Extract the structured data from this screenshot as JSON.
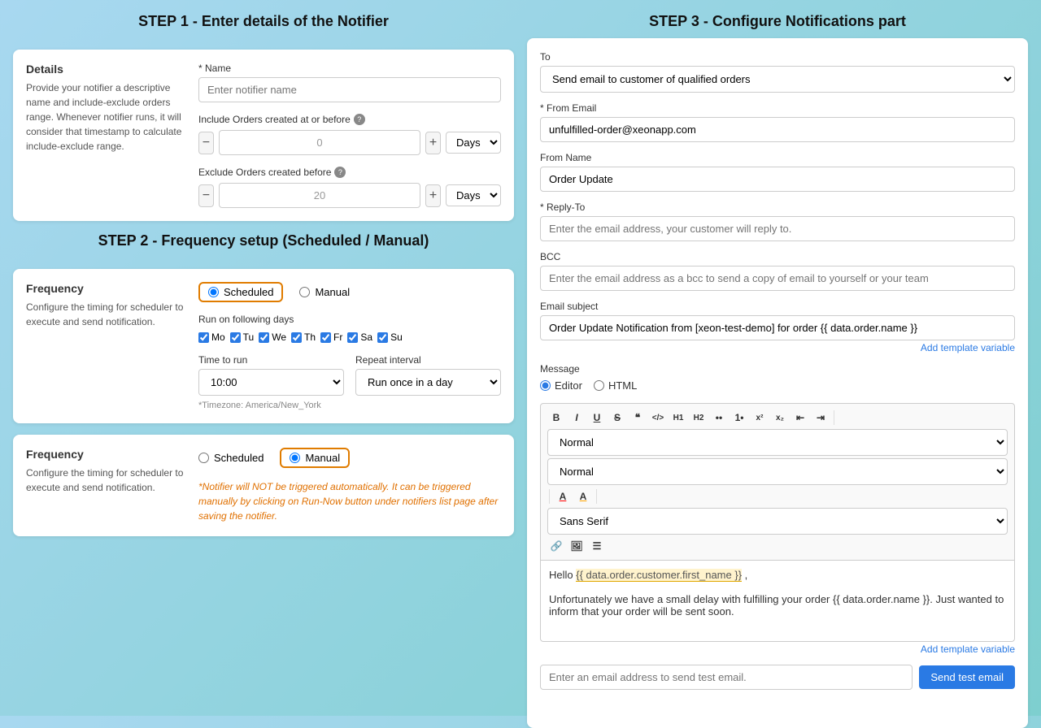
{
  "step1": {
    "title": "STEP 1 - Enter details of the Notifier",
    "details_card": {
      "heading": "Details",
      "description": "Provide your notifier a descriptive name and include-exclude orders range. Whenever notifier runs, it will consider that timestamp to calculate include-exclude range.",
      "name_label": "* Name",
      "name_placeholder": "Enter notifier name",
      "include_label": "Include Orders created at or before",
      "include_value": "0",
      "include_unit": "Days",
      "exclude_label": "Exclude Orders created before",
      "exclude_value": "20",
      "exclude_unit": "Days"
    }
  },
  "step2": {
    "title": "STEP 2 - Frequency setup (Scheduled / Manual)",
    "frequency_card_scheduled": {
      "heading": "Frequency",
      "description": "Configure the timing for scheduler to execute and send notification.",
      "option_scheduled": "Scheduled",
      "option_manual": "Manual",
      "days_label": "Run on following days",
      "days": [
        {
          "short": "Mo",
          "checked": true
        },
        {
          "short": "Tu",
          "checked": true
        },
        {
          "short": "We",
          "checked": true
        },
        {
          "short": "Th",
          "checked": true
        },
        {
          "short": "Fr",
          "checked": true
        },
        {
          "short": "Sa",
          "checked": true
        },
        {
          "short": "Su",
          "checked": true
        }
      ],
      "time_label": "Time to run",
      "time_value": "10:00",
      "repeat_label": "Repeat interval",
      "repeat_value": "Run once in a day",
      "timezone_note": "*Timezone: America/New_York"
    },
    "frequency_card_manual": {
      "heading": "Frequency",
      "description": "Configure the timing for scheduler to execute and send notification.",
      "option_scheduled": "Scheduled",
      "option_manual": "Manual",
      "manual_note": "*Notifier will NOT be triggered automatically. It can be triggered manually by clicking on Run-Now button under notifiers list page after saving the notifier."
    }
  },
  "step3": {
    "title": "STEP 3  - Configure Notifications part",
    "to_label": "To",
    "to_value": "Send email to customer of qualified orders",
    "from_email_label": "* From Email",
    "from_email_value": "unfulfilled-order@xeonapp.com",
    "from_name_label": "From Name",
    "from_name_value": "Order Update",
    "reply_to_label": "* Reply-To",
    "reply_to_placeholder": "Enter the email address, your customer will reply to.",
    "bcc_label": "BCC",
    "bcc_placeholder": "Enter the email address as a bcc to send a copy of email to yourself or your team",
    "email_subject_label": "Email subject",
    "email_subject_value": "Order Update Notification from [xeon-test-demo] for order {{ data.order.name }}",
    "add_template_variable": "Add template variable",
    "message_label": "Message",
    "editor_option": "Editor",
    "html_option": "HTML",
    "toolbar": {
      "bold": "B",
      "italic": "I",
      "underline": "U",
      "strikethrough": "S",
      "blockquote": "❝",
      "code": "</>",
      "h1": "H1",
      "h2": "H2",
      "bullet_list": "≡",
      "ordered_list": "≡",
      "superscript": "x²",
      "subscript": "x₂",
      "indent_left": "⇤",
      "indent_right": "⇥",
      "format_label": "Normal",
      "size_label": "Normal",
      "font_color": "A",
      "highlight_color": "A",
      "link": "🔗",
      "image": "🖼",
      "font_label": "Sans Serif",
      "align": "≡"
    },
    "message_text_1": "Hello {{ data.order.customer.first_name }} ,",
    "message_highlight": "data.order.customer.first_name",
    "message_text_2": "Unfortunately we have a small delay with fulfilling your order {{ data.order.name }}. Just wanted to inform that your order will be sent soon.",
    "add_template_variable2": "Add template variable",
    "test_email_placeholder": "Enter an email address to send test email.",
    "send_test_label": "Send test email"
  }
}
